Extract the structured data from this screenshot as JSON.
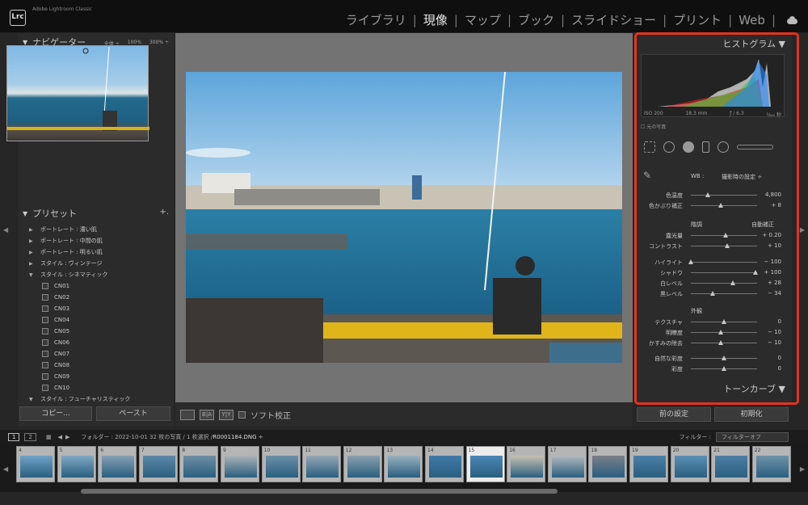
{
  "app": {
    "logo": "Lrc",
    "name": "Adobe Lightroom Classic"
  },
  "modules": [
    "ライブラリ",
    "現像",
    "マップ",
    "ブック",
    "スライドショー",
    "プリント",
    "Web"
  ],
  "active_module": "現像",
  "navigator": {
    "title": "ナビゲーター",
    "zoom": [
      "全体 ÷",
      "100%",
      "300% ÷"
    ]
  },
  "presets": {
    "title": "プリセット",
    "items": [
      {
        "label": "ポートレート : 濃い肌",
        "open": false,
        "level": 0
      },
      {
        "label": "ポートレート : 中間の肌",
        "open": false,
        "level": 0
      },
      {
        "label": "ポートレート : 明るい肌",
        "open": false,
        "level": 0
      },
      {
        "label": "スタイル : ヴィンテージ",
        "open": false,
        "level": 0
      },
      {
        "label": "スタイル : シネマティック",
        "open": true,
        "level": 0
      },
      {
        "label": "CN01",
        "level": 1
      },
      {
        "label": "CN02",
        "level": 1
      },
      {
        "label": "CN03",
        "level": 1
      },
      {
        "label": "CN04",
        "level": 1
      },
      {
        "label": "CN05",
        "level": 1
      },
      {
        "label": "CN06",
        "level": 1
      },
      {
        "label": "CN07",
        "level": 1
      },
      {
        "label": "CN08",
        "level": 1
      },
      {
        "label": "CN09",
        "level": 1
      },
      {
        "label": "CN10",
        "level": 1
      },
      {
        "label": "スタイル : フューチャリスティック",
        "open": true,
        "level": 0
      }
    ]
  },
  "left_buttons": {
    "copy": "コピー...",
    "paste": "ペースト"
  },
  "toolbar": {
    "soft_proof": "ソフト校正",
    "ba": "B|A",
    "yy": "Y|Y"
  },
  "histogram": {
    "title": "ヒストグラム",
    "iso": "ISO 200",
    "focal": "18.3 mm",
    "aperture": "ƒ / 6.3",
    "shutter": "¹⁄₆₄₀ 秒",
    "original": "元の写真"
  },
  "basic": {
    "wb_label": "WB :",
    "wb_value": "撮影時の設定 ÷",
    "temp": {
      "label": "色温度",
      "value": "4,800",
      "pos": 0.25
    },
    "tint": {
      "label": "色かぶり補正",
      "value": "+ 8",
      "pos": 0.45
    },
    "tone_title": "階調",
    "auto": "自動補正",
    "exposure": {
      "label": "露光量",
      "value": "+ 0.20",
      "pos": 0.52
    },
    "contrast": {
      "label": "コントラスト",
      "value": "+ 10",
      "pos": 0.55
    },
    "highlights": {
      "label": "ハイライト",
      "value": "− 100",
      "pos": 0.0
    },
    "shadows": {
      "label": "シャドウ",
      "value": "+ 100",
      "pos": 0.98
    },
    "whites": {
      "label": "白レベル",
      "value": "+ 28",
      "pos": 0.64
    },
    "blacks": {
      "label": "黒レベル",
      "value": "− 34",
      "pos": 0.33
    },
    "presence_title": "外観",
    "texture": {
      "label": "テクスチャ",
      "value": "0",
      "pos": 0.5
    },
    "clarity": {
      "label": "明瞭度",
      "value": "− 10",
      "pos": 0.45
    },
    "dehaze": {
      "label": "かすみの除去",
      "value": "− 10",
      "pos": 0.45
    },
    "vibrance": {
      "label": "自然な彩度",
      "value": "0",
      "pos": 0.5
    },
    "saturation": {
      "label": "彩度",
      "value": "0",
      "pos": 0.5
    }
  },
  "tonecurve": {
    "title": "トーンカーブ"
  },
  "right_buttons": {
    "prev": "前の設定",
    "reset": "初期化"
  },
  "filmbar": {
    "pages": [
      "1",
      "2"
    ],
    "folder": "フォルダー : 2022-10-01  32 枚の写真 / 1 枚選択 / ",
    "file": "R0001184.DNG ÷",
    "filter_label": "フィルター :",
    "filter_value": "フィルターオフ"
  },
  "film_numbers": [
    "4",
    "5",
    "6",
    "7",
    "8",
    "9",
    "10",
    "11",
    "12",
    "13",
    "14",
    "15",
    "16",
    "17",
    "18",
    "19",
    "20",
    "21",
    "22"
  ],
  "selected_frame": "15",
  "colors": {
    "accent_highlight": "#e4321e",
    "water": "#1f6f93",
    "sky": "#7db8e3"
  }
}
